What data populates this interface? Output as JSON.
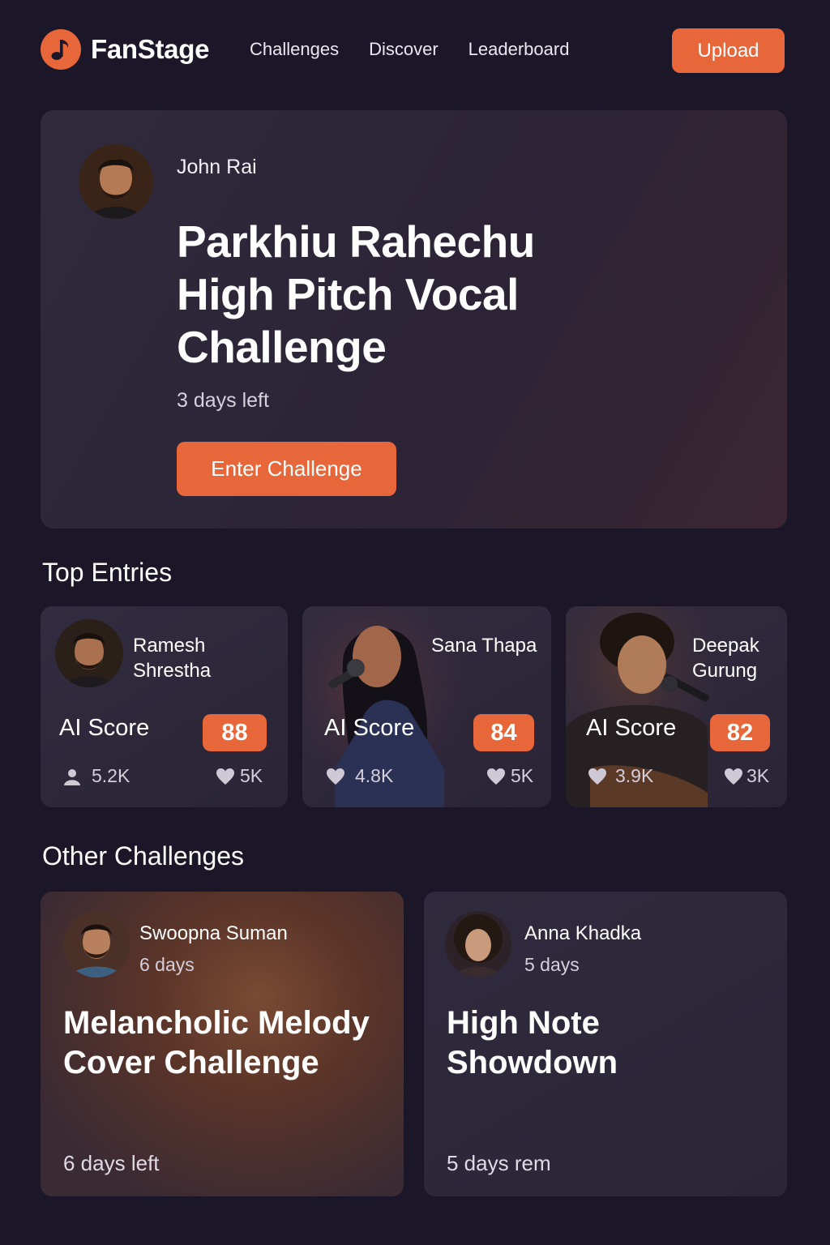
{
  "brand": {
    "name": "FanStage",
    "logo_icon": "music-note-icon",
    "accent": "#e8673a"
  },
  "nav": {
    "items": [
      "Challenges",
      "Discover",
      "Leaderboard"
    ],
    "upload_label": "Upload"
  },
  "hero": {
    "author": "John Rai",
    "title": "Parkhiu Rahechu High Pitch Vocal Challenge",
    "time_left": "3 days left",
    "cta_label": "Enter Challenge"
  },
  "top_entries": {
    "heading": "Top Entries",
    "entries": [
      {
        "name": "Ramesh Shrestha",
        "ai_label": "AI Score",
        "score": "88",
        "plays": "5.2K",
        "likes": "5K",
        "plays_icon": "user-icon"
      },
      {
        "name": "Sana Thapa",
        "ai_label": "AI Score",
        "score": "84",
        "plays": "4.8K",
        "likes": "5K",
        "plays_icon": "heart-icon"
      },
      {
        "name": "Deepak Gurung",
        "ai_label": "AI Score",
        "score": "82",
        "plays": "3.9K",
        "likes": "3K",
        "plays_icon": "heart-icon"
      }
    ]
  },
  "other_challenges": {
    "heading": "Other Challenges",
    "items": [
      {
        "author": "Swoopna Suman",
        "days": "6 days",
        "title": "Melancholic Melody Cover Challenge",
        "remaining": "6 days left"
      },
      {
        "author": "Anna Khadka",
        "days": "5 days",
        "title": "High Note Showdown",
        "remaining": "5 days rem"
      }
    ]
  }
}
